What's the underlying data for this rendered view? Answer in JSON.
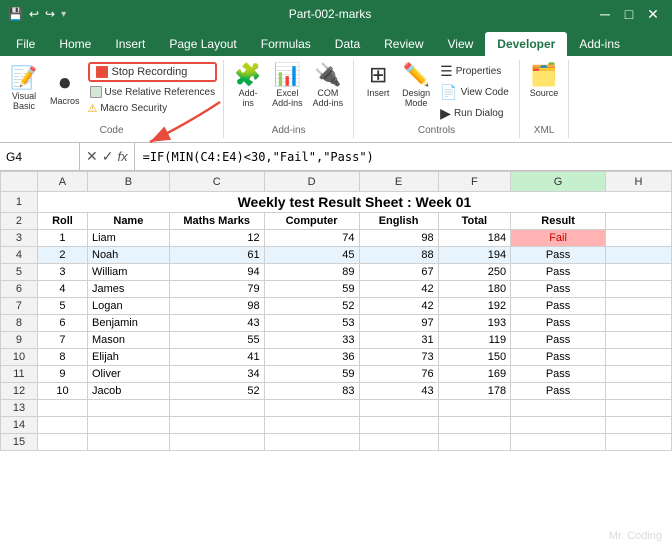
{
  "titleBar": {
    "title": "Part-002-marks",
    "saveIcon": "💾",
    "undoIcon": "↩",
    "redoIcon": "↪"
  },
  "ribbon": {
    "tabs": [
      "File",
      "Home",
      "Insert",
      "Page Layout",
      "Formulas",
      "Data",
      "Review",
      "View",
      "Developer",
      "Add-ins"
    ],
    "activeTab": "Developer",
    "groups": {
      "code": {
        "label": "Code",
        "buttons": [
          "Visual Basic",
          "Macros"
        ],
        "stopRecording": "Stop Recording",
        "useRelativeReferences": "Use Relative References",
        "macroSecurity": "Macro Security"
      },
      "addins": {
        "label": "Add-ins",
        "buttons": [
          "Add-ins",
          "Excel Add-ins",
          "COM Add-ins"
        ]
      },
      "controls": {
        "label": "Controls",
        "buttons": [
          "Insert",
          "Design Mode",
          "Properties",
          "View Code",
          "Run Dialog"
        ]
      },
      "xml": {
        "label": "XML",
        "buttons": [
          "Source"
        ]
      }
    }
  },
  "formulaBar": {
    "nameBox": "G4",
    "formula": "=IF(MIN(C4:E4)<30,\"Fail\",\"Pass\")"
  },
  "columns": [
    "",
    "A",
    "B",
    "C",
    "D",
    "E",
    "F",
    "G",
    "H"
  ],
  "sheetTitle": "Weekly test Result Sheet : Week 01",
  "headers": [
    "Roll",
    "Name",
    "Maths Marks",
    "Computer",
    "English",
    "Total",
    "Result"
  ],
  "rows": [
    {
      "roll": 1,
      "name": "Liam",
      "maths": 12,
      "computer": 74,
      "english": 98,
      "total": 184,
      "result": "Fail",
      "fail": true
    },
    {
      "roll": 2,
      "name": "Noah",
      "maths": 61,
      "computer": 45,
      "english": 88,
      "total": 194,
      "result": "Pass",
      "fail": false
    },
    {
      "roll": 3,
      "name": "William",
      "maths": 94,
      "computer": 89,
      "english": 67,
      "total": 250,
      "result": "Pass",
      "fail": false
    },
    {
      "roll": 4,
      "name": "James",
      "maths": 79,
      "computer": 59,
      "english": 42,
      "total": 180,
      "result": "Pass",
      "fail": false
    },
    {
      "roll": 5,
      "name": "Logan",
      "maths": 98,
      "computer": 52,
      "english": 42,
      "total": 192,
      "result": "Pass",
      "fail": false
    },
    {
      "roll": 6,
      "name": "Benjamin",
      "maths": 43,
      "computer": 53,
      "english": 97,
      "total": 193,
      "result": "Pass",
      "fail": false
    },
    {
      "roll": 7,
      "name": "Mason",
      "maths": 55,
      "computer": 33,
      "english": 31,
      "total": 119,
      "result": "Pass",
      "fail": false
    },
    {
      "roll": 8,
      "name": "Elijah",
      "maths": 41,
      "computer": 36,
      "english": 73,
      "total": 150,
      "result": "Pass",
      "fail": false
    },
    {
      "roll": 9,
      "name": "Oliver",
      "maths": 34,
      "computer": 59,
      "english": 76,
      "total": 169,
      "result": "Pass",
      "fail": false
    },
    {
      "roll": 10,
      "name": "Jacob",
      "maths": 52,
      "computer": 83,
      "english": 43,
      "total": 178,
      "result": "Pass",
      "fail": false
    }
  ],
  "emptyRows": [
    13,
    14,
    15
  ],
  "watermark": "Mr. Coding"
}
